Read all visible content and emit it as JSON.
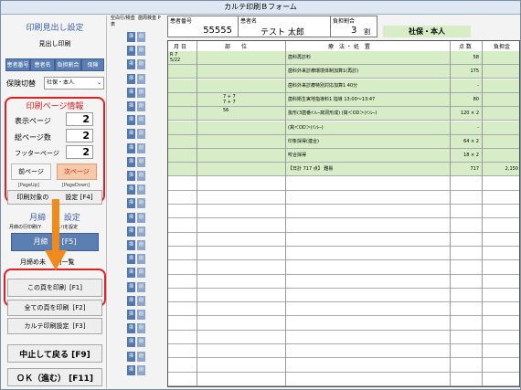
{
  "window": {
    "title": "カルテ印刷Ｂフォーム"
  },
  "left": {
    "heading_print_header": "印刷見出し設定",
    "print_header_label": "見出し印刷",
    "tag_buttons": [
      "患者番号",
      "患者名",
      "負担割合",
      "保険"
    ],
    "insurance_switch_label": "保険切替",
    "insurance_select_value": "社保・本人",
    "page_info_heading": "印刷ページ情報",
    "display_page_label": "表示ページ",
    "display_page_value": "2",
    "total_pages_label": "総ページ数",
    "total_pages_value": "2",
    "footer_page_label": "フッターページ",
    "footer_page_value": "2",
    "prev_page_label": "前ページ",
    "prev_page_key": "[PageUp]",
    "next_page_label": "次ページ",
    "next_page_key": "[PageDown]",
    "print_target_label": "印刷対象の",
    "print_target_suffix": "設定 [F4]",
    "monthly_heading_left": "月締",
    "monthly_heading_right": "設定",
    "monthly_sub_left": "月締の行印刷(Y",
    "monthly_sub_right": "ない)を設定",
    "monthly_button_left": "月締",
    "monthly_button_right": "[F5]",
    "monthly_list_left": "月締め未",
    "monthly_list_right": "刷一覧",
    "print_this_label": "この頁を印刷",
    "print_this_key": "[F1]",
    "print_all_label": "全ての頁を印刷",
    "print_all_key": "[F2]",
    "karte_settings_label": "カルテ印刷設定",
    "karte_settings_key": "[F3]",
    "cancel_label": "中止して戻る [F9]",
    "ok_label": "ＯＫ（進む）  [F11]"
  },
  "strip": {
    "header_col1": "空白行/検査表",
    "header_col2": "歯周検査 P",
    "btn1": "挿",
    "btn2": "削"
  },
  "patient": {
    "id_label": "患者番号",
    "id_value": "55555",
    "name_label": "患者名",
    "name_value": "テスト 太郎",
    "burden_label": "負担割合",
    "burden_value": "3",
    "burden_unit": "割",
    "insurance_type": "社保・本人"
  },
  "table": {
    "headers": {
      "date": "月 日",
      "part": "部　　位",
      "treatment": "療　法 ・ 処　置",
      "points": "点 数",
      "cost": "負担金"
    },
    "rows": [
      {
        "date": "R 7\n5/22",
        "part": "",
        "treatment": "歯科再診料",
        "points": "58",
        "cost": ""
      },
      {
        "date": "",
        "part": "",
        "treatment": "歯科外来診療環境体制加算1(再診)",
        "points": "175",
        "cost": ""
      },
      {
        "date": "",
        "part": "",
        "treatment": "歯科外来診療特別対応加算1 40分",
        "points": "-",
        "cost": ""
      },
      {
        "date": "",
        "part": "7 + 7\n7 + 7",
        "treatment": "歯科衛生実地指導料1  指導 13:00〜13:47",
        "points": "80",
        "cost": ""
      },
      {
        "date": "",
        "part": "56",
        "treatment": "抜形(3歯番ｲﾝﾚｰ窩洞形成)  (窩＜OD＞(ｲﾝﾚｰ)",
        "points": "120 × 2",
        "cost": ""
      },
      {
        "date": "",
        "part": "",
        "treatment": "(窩＜OD＞(ｲﾝﾚｰ)",
        "points": "-",
        "cost": ""
      },
      {
        "date": "",
        "part": "",
        "treatment": "印象採得(連合)",
        "points": "64 × 2",
        "cost": ""
      },
      {
        "date": "",
        "part": "",
        "treatment": "咬合採得",
        "points": "18 × 2",
        "cost": ""
      },
      {
        "date": "",
        "part": "",
        "treatment": "【日計  717 点】    難易",
        "points": "717",
        "cost": "2,150"
      }
    ]
  },
  "colors": {
    "accent_blue": "#5b7fb2",
    "highlight_red": "#e02020",
    "row_green": "#d7edc8",
    "arrow_orange": "#f08a1c"
  }
}
